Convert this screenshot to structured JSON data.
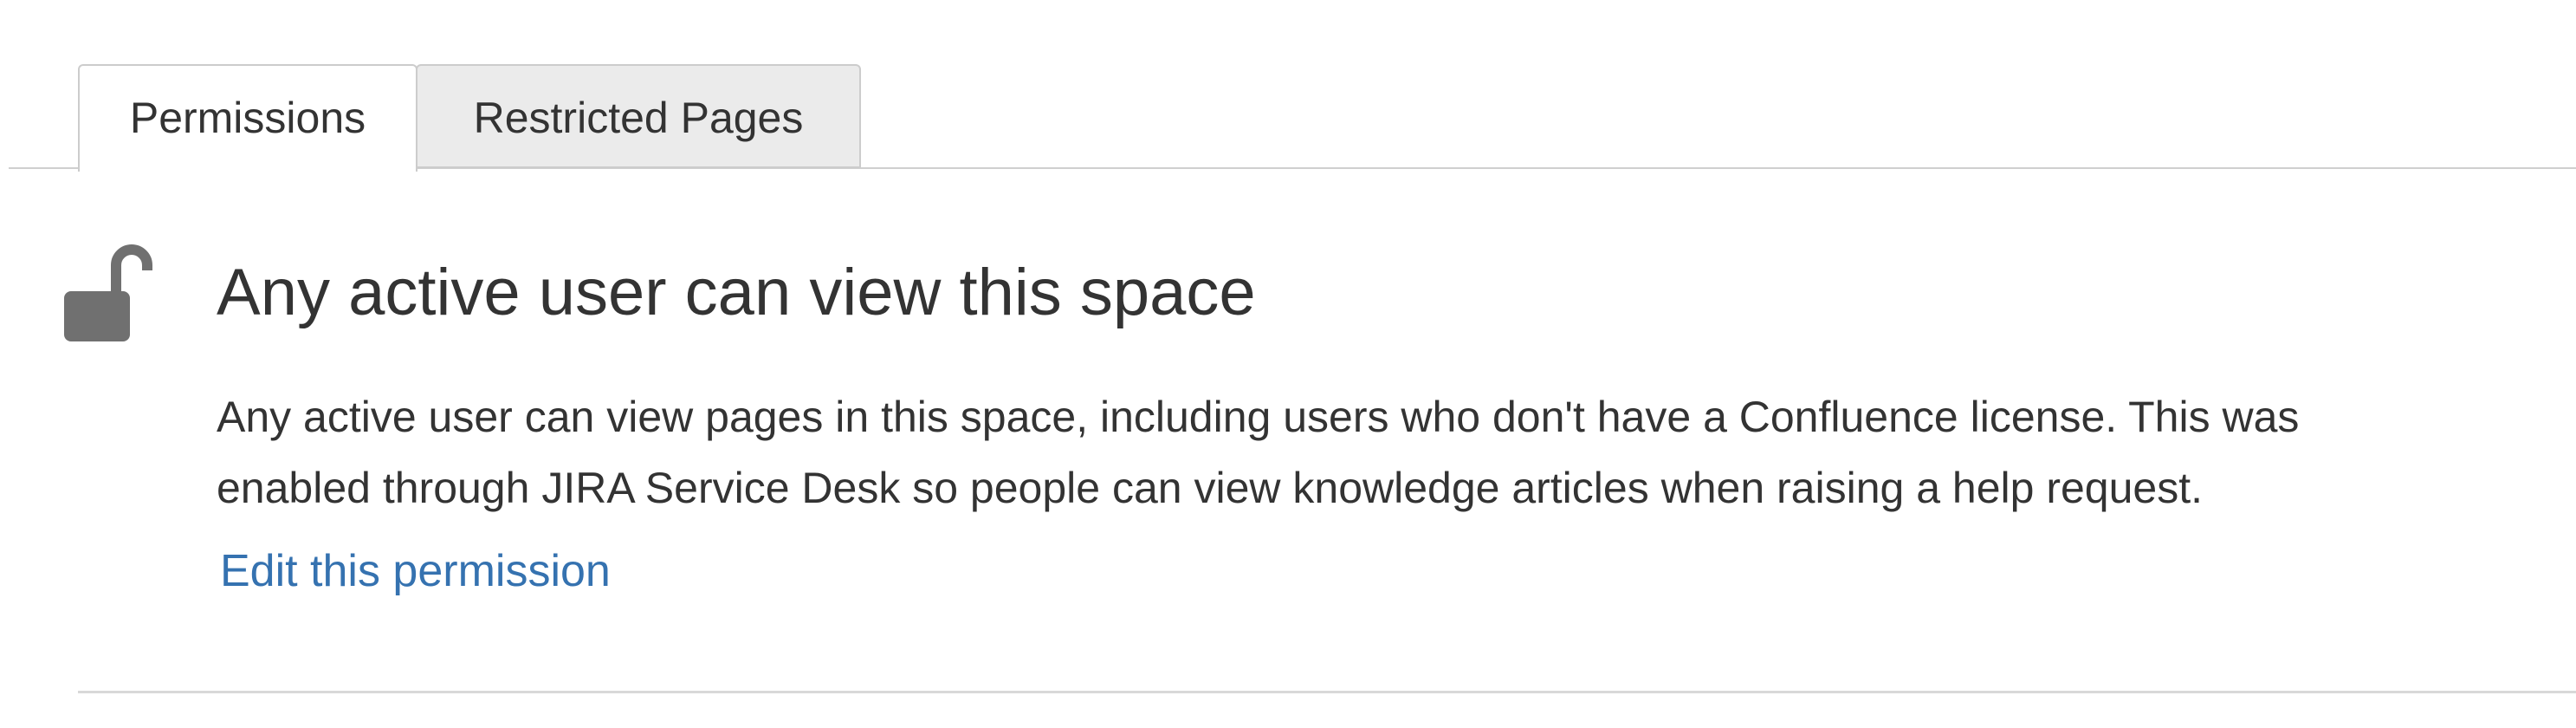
{
  "tabs": [
    {
      "label": "Permissions",
      "active": true
    },
    {
      "label": "Restricted Pages",
      "active": false
    }
  ],
  "permission": {
    "icon": "unlocked-padlock-icon",
    "title": "Any active user can view this space",
    "description_lines": [
      "Any active user can view pages in this space, including users who don't have a Confluence license. This was",
      "enabled through JIRA Service Desk so people can view knowledge articles when raising a help request."
    ],
    "edit_link": "Edit this permission"
  },
  "colors": {
    "link": "#3572b0",
    "text": "#333333",
    "icon": "#707070",
    "inactive_tab": "#ebebeb"
  }
}
